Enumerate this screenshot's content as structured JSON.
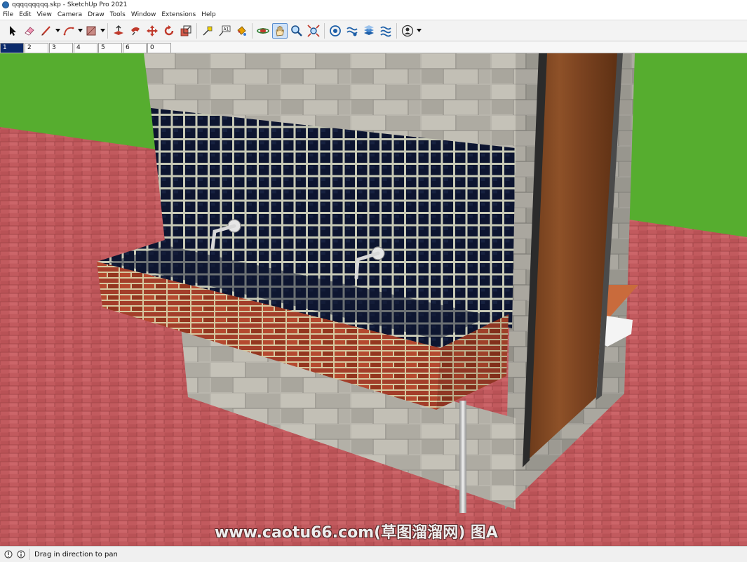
{
  "window": {
    "title": "qqqqqqqqq.skp - SketchUp Pro 2021"
  },
  "menu": [
    "File",
    "Edit",
    "View",
    "Camera",
    "Draw",
    "Tools",
    "Window",
    "Extensions",
    "Help"
  ],
  "toolbar": {
    "active_tool": "pan-icon",
    "tools": [
      "select-icon",
      "eraser-icon",
      "line-icon",
      "arc-icon",
      "rectangle-icon",
      "push-pull-icon",
      "follow-me-icon",
      "move-icon",
      "rotate-icon",
      "scale-icon",
      "tape-measure-icon",
      "text-icon",
      "paint-bucket-icon",
      "orbit-icon",
      "pan-icon",
      "zoom-icon",
      "zoom-extents-icon",
      "3d-warehouse-icon",
      "extension-warehouse-icon",
      "layout-icon",
      "extension-manager-icon",
      "account-icon"
    ]
  },
  "scenes": {
    "tabs": [
      "1",
      "2",
      "3",
      "4",
      "5",
      "6",
      "0"
    ],
    "selected": "1"
  },
  "viewport": {
    "watermark": "www.caotu66.com(草图溜溜网) 图A"
  },
  "status": {
    "message": "Drag in direction to pan"
  }
}
